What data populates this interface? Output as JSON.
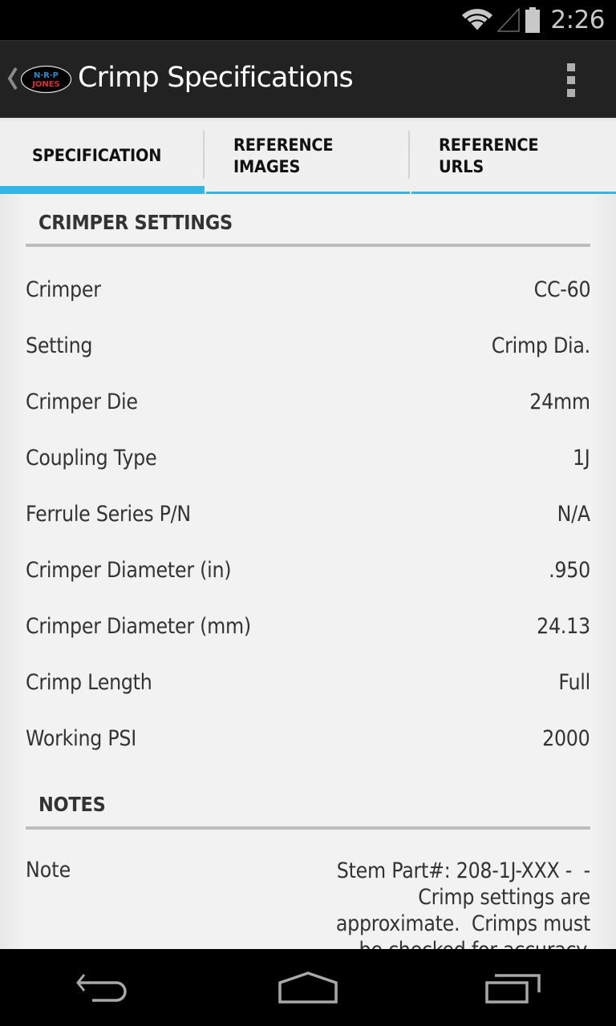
{
  "status_bar": {
    "time": "2:26",
    "icons": [
      "wifi-icon",
      "cell-signal-icon",
      "battery-icon"
    ]
  },
  "action_bar": {
    "title": "Crimp Specifications",
    "logo": {
      "top_text": "N·R·P",
      "bottom_text": "JONES"
    },
    "overflow_icon": "overflow-menu-icon"
  },
  "tabs": [
    {
      "label": "SPECIFICATION",
      "active": true
    },
    {
      "label": "REFERENCE\nIMAGES",
      "active": false
    },
    {
      "label": "REFERENCE\nURLS",
      "active": false
    }
  ],
  "crimper_settings": {
    "title": "CRIMPER SETTINGS",
    "rows": [
      {
        "label": "Crimper",
        "value": "CC-60"
      },
      {
        "label": "Setting",
        "value": "Crimp Dia."
      },
      {
        "label": "Crimper Die",
        "value": "24mm"
      },
      {
        "label": "Coupling Type",
        "value": "1J"
      },
      {
        "label": "Ferrule Series P/N",
        "value": "N/A"
      },
      {
        "label": "Crimper Diameter (in)",
        "value": ".950"
      },
      {
        "label": "Crimper Diameter (mm)",
        "value": "24.13"
      },
      {
        "label": "Crimp Length",
        "value": "Full"
      },
      {
        "label": "Working PSI",
        "value": "2000"
      }
    ]
  },
  "notes": {
    "title": "NOTES",
    "label": "Note",
    "text": "Stem Part#: 208-1J-XXX -  -\nCrimp settings are\napproximate.  Crimps must\nbe checked for accuracy."
  },
  "nav_bar": {
    "buttons": [
      "back-icon",
      "home-icon",
      "recent-apps-icon"
    ]
  },
  "colors": {
    "accent": "#33b5e5",
    "action_bar": "#222222",
    "content_bg": "#f2f2f2",
    "text": "#333333"
  }
}
